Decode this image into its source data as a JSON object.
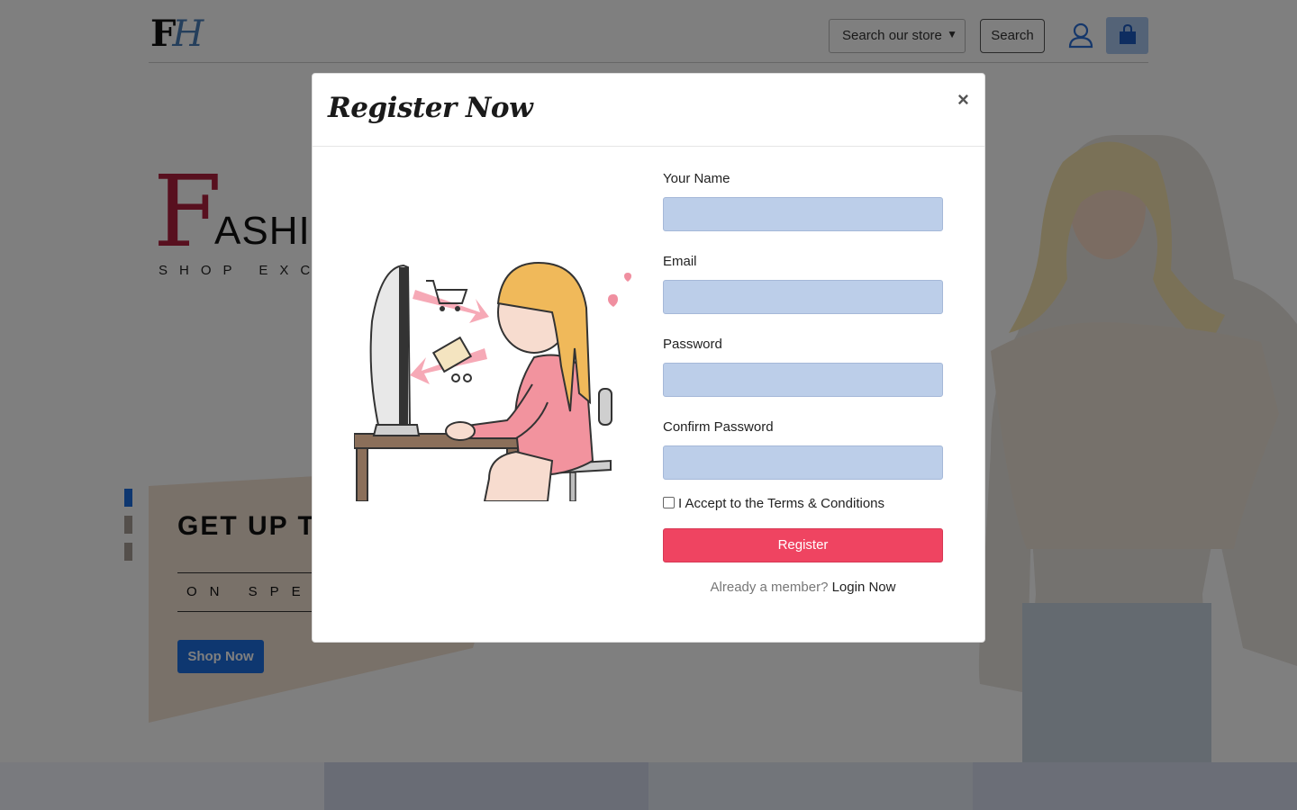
{
  "header": {
    "logo_f": "F",
    "logo_h": "H",
    "search_select_value": "Search our store",
    "search_button": "Search"
  },
  "hero": {
    "big_letter": "F",
    "word": "ASHIO",
    "subtitle": "SHOP EXCLU",
    "promo_title": "GET UP TO",
    "promo_sub": "ON SPE",
    "shop_now": "Shop Now"
  },
  "modal": {
    "title": "Register Now",
    "close": "×",
    "fields": [
      {
        "label": "Your Name",
        "value": ""
      },
      {
        "label": "Email",
        "value": ""
      },
      {
        "label": "Password",
        "value": ""
      },
      {
        "label": "Confirm Password",
        "value": ""
      }
    ],
    "terms_label": "I Accept to the Terms & Conditions",
    "terms_checked": false,
    "register_button": "Register",
    "member_text": "Already a member?",
    "login_link": "Login Now"
  },
  "colors": {
    "accent_blue": "#1d6fe0",
    "register_red": "#ef4461",
    "input_fill": "#bccee9",
    "cart_bg": "#a9c6ef"
  }
}
